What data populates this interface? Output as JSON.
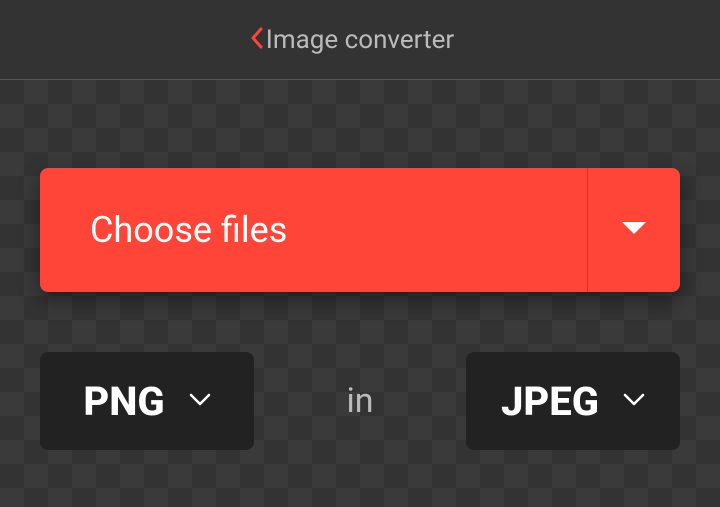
{
  "header": {
    "title": "Image converter"
  },
  "choose": {
    "label": "Choose files"
  },
  "formats": {
    "source": "PNG",
    "target": "JPEG",
    "separator": "in"
  },
  "colors": {
    "accent": "#ff4438",
    "dark": "#222222",
    "bg": "#333333"
  }
}
